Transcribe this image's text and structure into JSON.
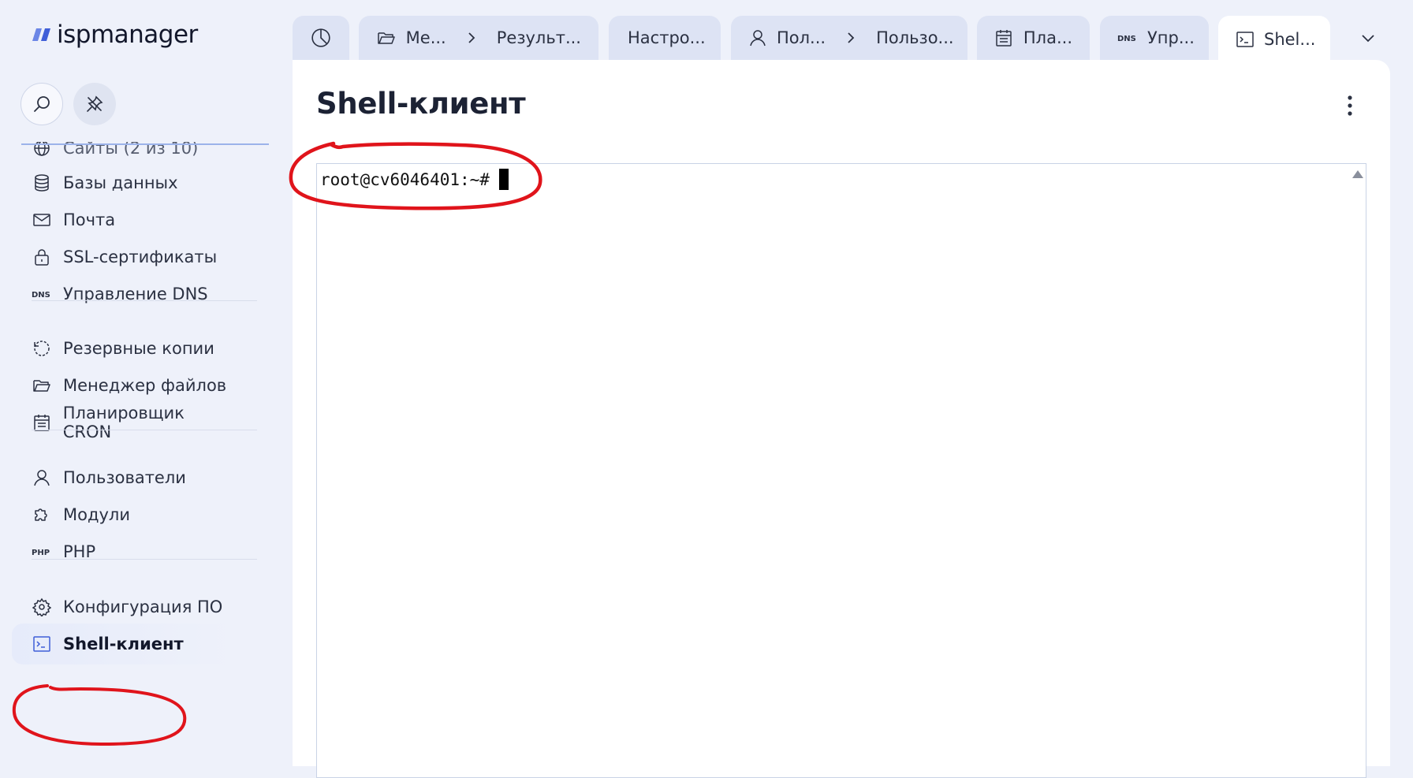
{
  "app": {
    "logo_text": "ispmanager"
  },
  "sidebar": {
    "clipped_item": "Сайты (2 из 10)",
    "items": [
      {
        "label": "Базы данных",
        "icon": "database-icon"
      },
      {
        "label": "Почта",
        "icon": "mail-icon"
      },
      {
        "label": "SSL-сертификаты",
        "icon": "lock-icon"
      },
      {
        "label": "Управление DNS",
        "icon": "dns-icon"
      },
      {
        "label": "Резервные копии",
        "icon": "backup-icon"
      },
      {
        "label": "Менеджер файлов",
        "icon": "folder-icon"
      },
      {
        "label": "Планировщик CRON",
        "icon": "calendar-icon"
      },
      {
        "label": "Пользователи",
        "icon": "user-icon"
      },
      {
        "label": "Модули",
        "icon": "puzzle-icon"
      },
      {
        "label": "PHP",
        "icon": "php-icon"
      },
      {
        "label": "Конфигурация ПО",
        "icon": "gear-icon"
      },
      {
        "label": "Shell-клиент",
        "icon": "terminal-icon",
        "active": true
      }
    ]
  },
  "tabs": [
    {
      "icon": "dashboard-icon"
    },
    {
      "icon": "folder-icon",
      "label": "Ме...",
      "sub_label": "Результ..."
    },
    {
      "label": "Настро..."
    },
    {
      "icon": "user-icon",
      "label": "Пол...",
      "sub_label": "Пользо..."
    },
    {
      "icon": "calendar-icon",
      "label": "Пла..."
    },
    {
      "icon": "dns-icon",
      "label": "Упр..."
    },
    {
      "icon": "terminal-icon",
      "label": "Shel...",
      "active": true
    }
  ],
  "main": {
    "title": "Shell-клиент",
    "terminal_prompt": "root@cv6046401:~#"
  },
  "colors": {
    "accent": "#3f5ed8",
    "annotation": "#e0141b",
    "sidebar_bg": "#eef1fa",
    "tab_bg": "#dde3f4"
  }
}
